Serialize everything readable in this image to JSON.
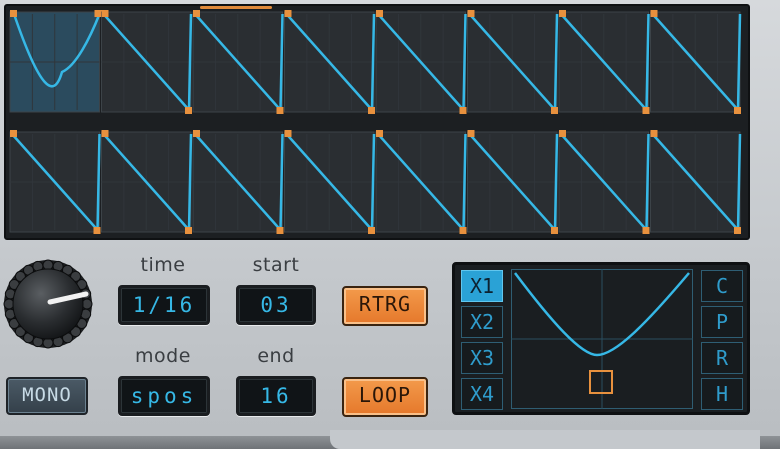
{
  "panel": {
    "time_label": "time",
    "start_label": "start",
    "mode_label": "mode",
    "end_label": "end",
    "time_value": "1/16",
    "start_value": "03",
    "mode_value": "spos",
    "end_value": "16",
    "mono_label": "MONO",
    "retrigger_label": "RTRG",
    "loop_label": "LOOP"
  },
  "shape_panel": {
    "speed_buttons": [
      "X1",
      "X2",
      "X3",
      "X4"
    ],
    "selected_speed": "X1",
    "side_buttons": [
      "C",
      "P",
      "R",
      "H"
    ]
  },
  "steps": {
    "row1": [
      "curve",
      "saw",
      "saw",
      "saw",
      "saw",
      "saw",
      "saw",
      "saw"
    ],
    "row2": [
      "saw",
      "saw",
      "saw",
      "saw",
      "saw",
      "saw",
      "saw",
      "saw"
    ],
    "selected_step": 1
  },
  "colors": {
    "line": "#36b8e6",
    "handle": "#e8913e",
    "active_btn": "#2aa2d6",
    "orange_btn": "#ec8a3c"
  }
}
